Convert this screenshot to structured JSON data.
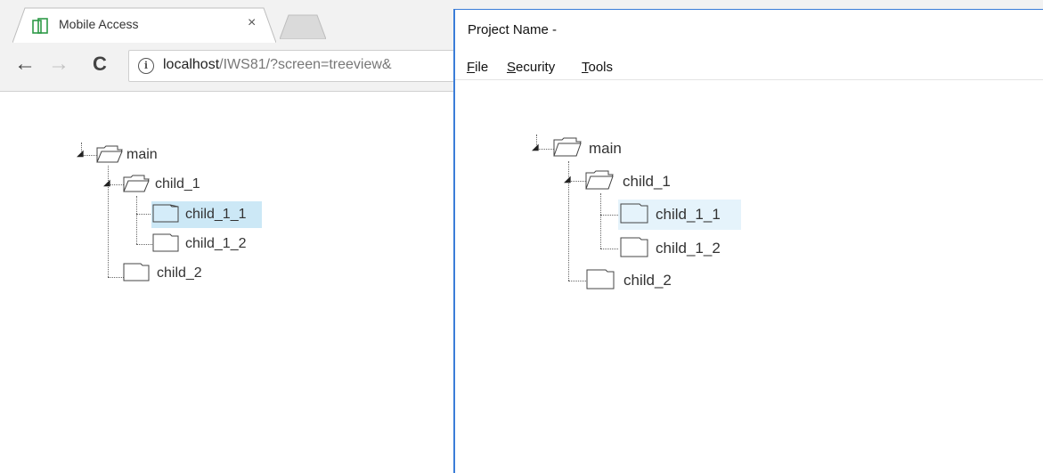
{
  "browser": {
    "tab": {
      "title": "Mobile Access",
      "close": "×"
    },
    "toolbar": {
      "back": "←",
      "forward": "→",
      "reload": "C",
      "info": "i",
      "url_host": "localhost",
      "url_path": "/IWS81/?screen=treeview&"
    }
  },
  "tree_browser": {
    "nodes": [
      {
        "label": "main"
      },
      {
        "label": "child_1"
      },
      {
        "label": "child_1_1"
      },
      {
        "label": "child_1_2"
      },
      {
        "label": "child_2"
      }
    ]
  },
  "app_window": {
    "title": "Project Name -",
    "menu": [
      {
        "first": "F",
        "rest": "ile"
      },
      {
        "first": "S",
        "rest": "ecurity"
      },
      {
        "first": "T",
        "rest": "ools"
      }
    ],
    "tree": {
      "nodes": [
        {
          "label": "main"
        },
        {
          "label": "child_1"
        },
        {
          "label": "child_1_1"
        },
        {
          "label": "child_1_2"
        },
        {
          "label": "child_2"
        }
      ]
    }
  },
  "colors": {
    "selection": "#cce8f6",
    "selection_light": "#e5f3fb",
    "window_border": "#3b7dd8",
    "tab_icon": "#2e9a48"
  }
}
